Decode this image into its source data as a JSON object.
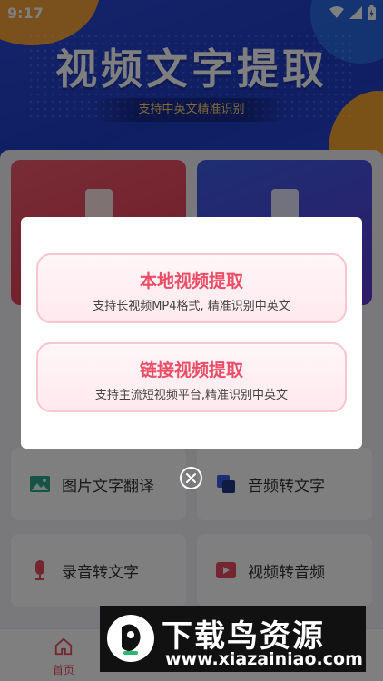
{
  "status_bar": {
    "time": "9:17"
  },
  "banner": {
    "title": "视频文字提取",
    "subtitle": "支持中英文精准识别"
  },
  "tiles": [
    {
      "label": "图片文字翻译",
      "icon": "image-icon"
    },
    {
      "label": "音频转文字",
      "icon": "audio-icon"
    },
    {
      "label": "录音转文字",
      "icon": "microphone-icon"
    },
    {
      "label": "视频转音频",
      "icon": "video-icon"
    }
  ],
  "bottom_nav": {
    "items": [
      {
        "label": "首页",
        "icon": "home-icon",
        "active": true
      },
      {
        "label": "",
        "icon": "tools-icon"
      },
      {
        "label": "",
        "icon": "profile-icon"
      }
    ]
  },
  "dialog": {
    "options": [
      {
        "title": "本地视频提取",
        "description": "支持长视频MP4格式, 精准识别中英文"
      },
      {
        "title": "链接视频提取",
        "description": "支持主流短视频平台,精准识别中英文"
      }
    ]
  },
  "watermark": {
    "title": "下载鸟资源",
    "url": "www.xiazainiao.com"
  },
  "colors": {
    "accent": "#ec4d67",
    "banner": "#2c4ad6",
    "overlay": "rgba(0,0,0,0.5)"
  }
}
